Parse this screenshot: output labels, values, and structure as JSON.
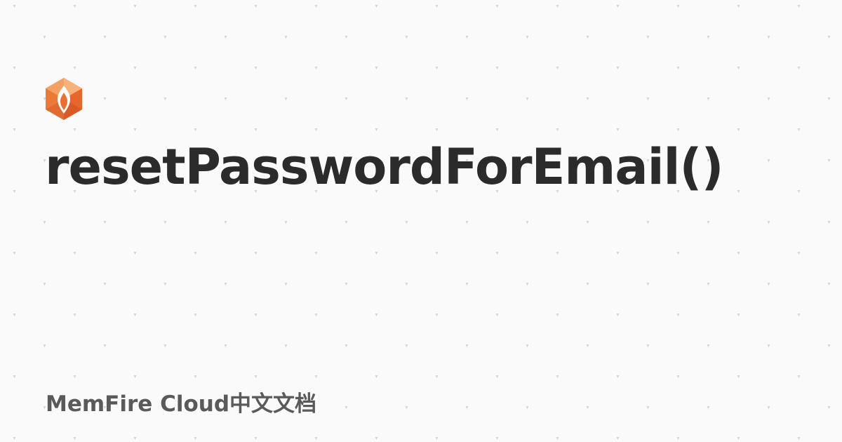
{
  "title": "resetPasswordForEmail()",
  "footer": "MemFire Cloud中文文档",
  "logo": {
    "icon": "memfire-flame-hexagon-icon",
    "colors": [
      "#f7b27a",
      "#f08a3e",
      "#e8652c",
      "#ffffff"
    ]
  },
  "colors": {
    "background": "#fafafa",
    "dot": "#d4d4d4",
    "title": "#2b2b2b",
    "footer": "#5a5a5a"
  }
}
